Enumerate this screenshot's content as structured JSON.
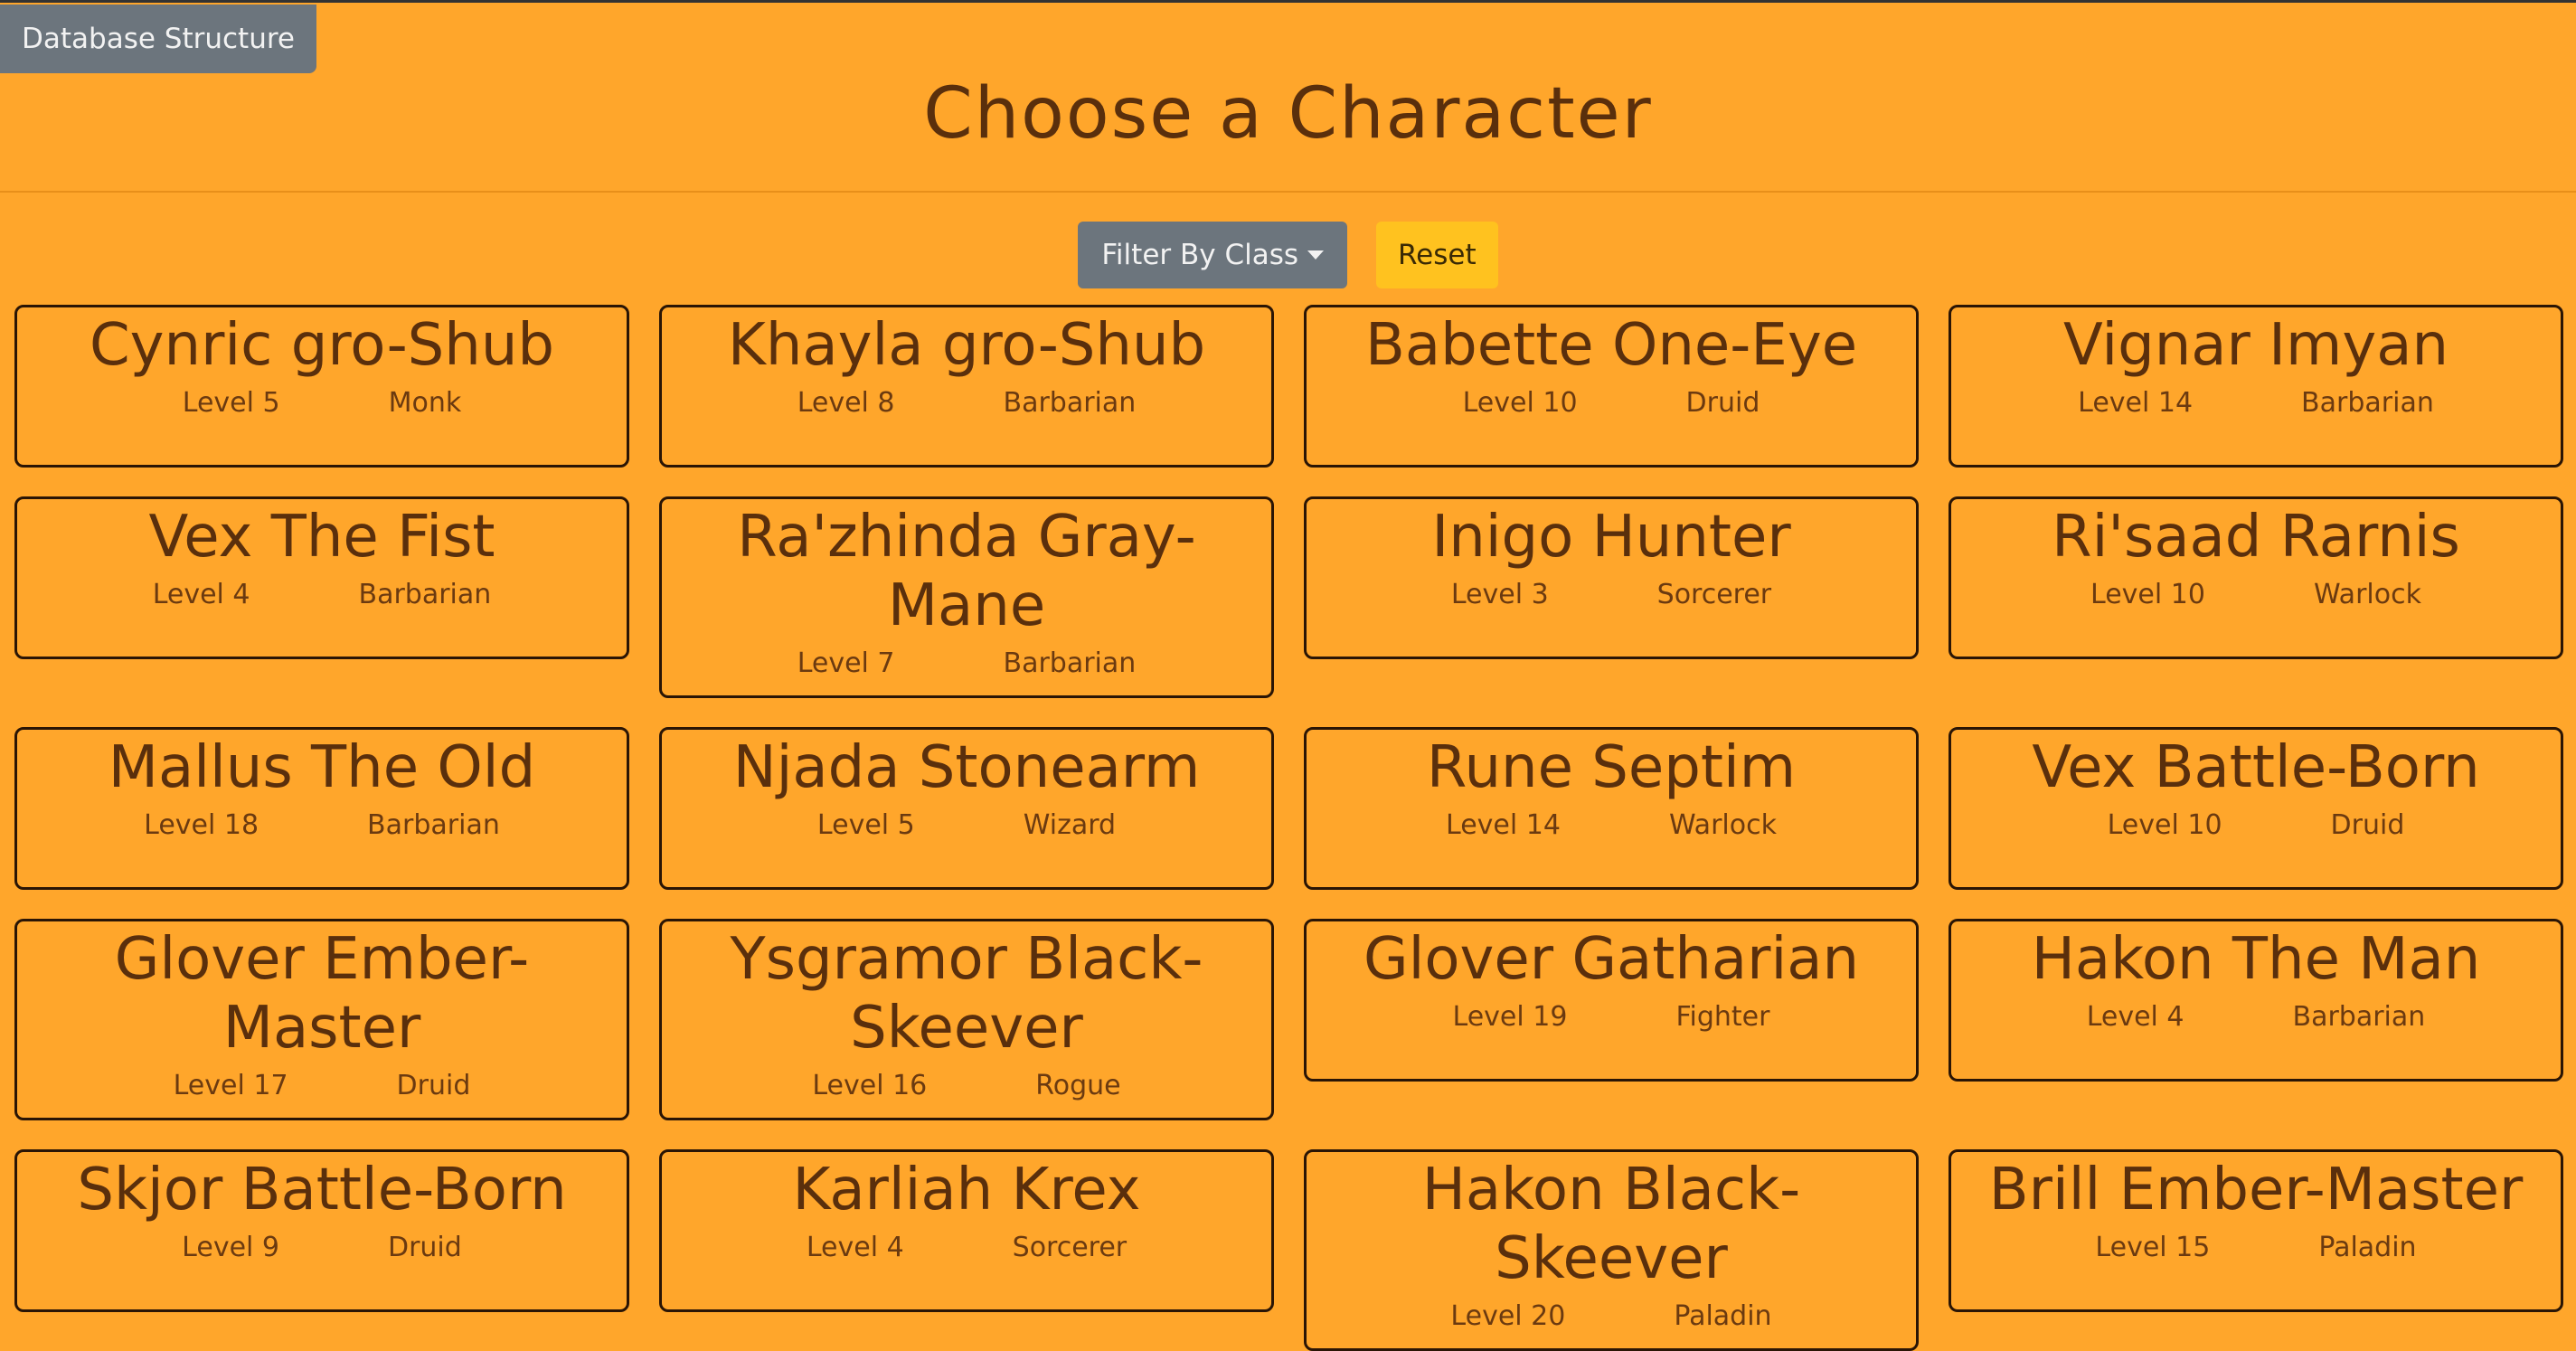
{
  "header": {
    "db_button": "Database Structure",
    "title": "Choose a Character"
  },
  "controls": {
    "filter_label": "Filter By Class",
    "reset_label": "Reset"
  },
  "characters": [
    {
      "name": "Cynric gro-Shub",
      "level": "Level 5",
      "class": "Monk"
    },
    {
      "name": "Khayla gro-Shub",
      "level": "Level 8",
      "class": "Barbarian"
    },
    {
      "name": "Babette One-Eye",
      "level": "Level 10",
      "class": "Druid"
    },
    {
      "name": "Vignar Imyan",
      "level": "Level 14",
      "class": "Barbarian"
    },
    {
      "name": "Vex The Fist",
      "level": "Level 4",
      "class": "Barbarian"
    },
    {
      "name": "Ra'zhinda Gray-Mane",
      "level": "Level 7",
      "class": "Barbarian"
    },
    {
      "name": "Inigo Hunter",
      "level": "Level 3",
      "class": "Sorcerer"
    },
    {
      "name": "Ri'saad Rarnis",
      "level": "Level 10",
      "class": "Warlock"
    },
    {
      "name": "Mallus The Old",
      "level": "Level 18",
      "class": "Barbarian"
    },
    {
      "name": "Njada Stonearm",
      "level": "Level 5",
      "class": "Wizard"
    },
    {
      "name": "Rune Septim",
      "level": "Level 14",
      "class": "Warlock"
    },
    {
      "name": "Vex Battle-Born",
      "level": "Level 10",
      "class": "Druid"
    },
    {
      "name": "Glover Ember-Master",
      "level": "Level 17",
      "class": "Druid"
    },
    {
      "name": "Ysgramor Black-Skeever",
      "level": "Level 16",
      "class": "Rogue"
    },
    {
      "name": "Glover Gatharian",
      "level": "Level 19",
      "class": "Fighter"
    },
    {
      "name": "Hakon The Man",
      "level": "Level 4",
      "class": "Barbarian"
    },
    {
      "name": "Skjor Battle-Born",
      "level": "Level 9",
      "class": "Druid"
    },
    {
      "name": "Karliah Krex",
      "level": "Level 4",
      "class": "Sorcerer"
    },
    {
      "name": "Hakon Black-Skeever",
      "level": "Level 20",
      "class": "Paladin"
    },
    {
      "name": "Brill Ember-Master",
      "level": "Level 15",
      "class": "Paladin"
    }
  ]
}
